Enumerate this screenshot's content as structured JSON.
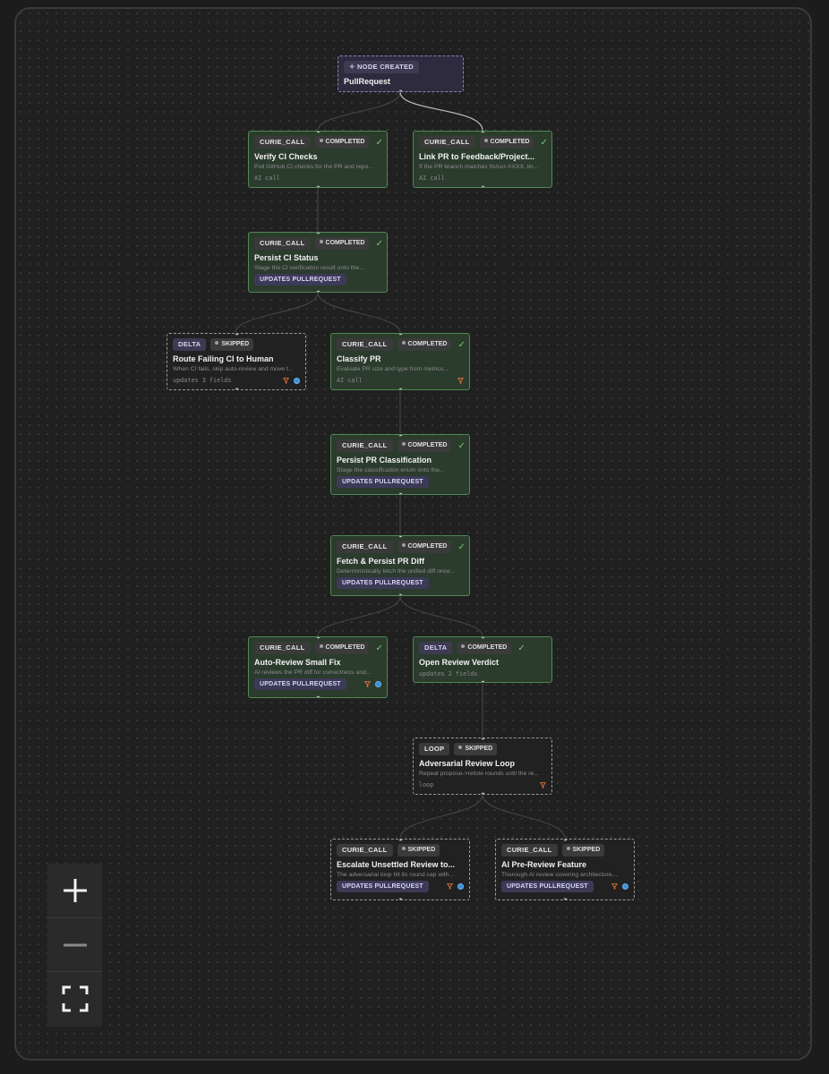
{
  "graph": {
    "root": {
      "kind": "NODE CREATED",
      "title": "PullRequest"
    },
    "nodes": [
      {
        "kind": "CURIE_CALL",
        "status": "COMPLETED",
        "title": "Verify CI Checks",
        "desc": "Poll GitHub CI checks for the PR and repo...",
        "footer": "AI call"
      },
      {
        "kind": "CURIE_CALL",
        "status": "COMPLETED",
        "title": "Link PR to Feedback/Project...",
        "desc": "If the PR branch matches fix/cur-XXXX, lin...",
        "footer": "AI call"
      },
      {
        "kind": "CURIE_CALL",
        "status": "COMPLETED",
        "title": "Persist CI Status",
        "desc": "Stage the CI verification result onto the...",
        "badge": "UPDATES PULLREQUEST"
      },
      {
        "kind": "DELTA",
        "status": "SKIPPED",
        "title": "Route Failing CI to Human",
        "desc": "When CI fails, skip auto-review and move t...",
        "footer": "updates 3 fields"
      },
      {
        "kind": "CURIE_CALL",
        "status": "COMPLETED",
        "title": "Classify PR",
        "desc": "Evaluate PR size and type from metrics...",
        "footer": "AI call"
      },
      {
        "kind": "CURIE_CALL",
        "status": "COMPLETED",
        "title": "Persist PR Classification",
        "desc": "Stage the classification enum onto the...",
        "badge": "UPDATES PULLREQUEST"
      },
      {
        "kind": "CURIE_CALL",
        "status": "COMPLETED",
        "title": "Fetch & Persist PR Diff",
        "desc": "Deterministically fetch the unified diff once...",
        "badge": "UPDATES PULLREQUEST"
      },
      {
        "kind": "CURIE_CALL",
        "status": "COMPLETED",
        "title": "Auto-Review Small Fix",
        "desc": "AI reviews the PR diff for correctness and...",
        "badge": "UPDATES PULLREQUEST"
      },
      {
        "kind": "DELTA",
        "status": "COMPLETED",
        "title": "Open Review Verdict",
        "footer": "updates 2 fields"
      },
      {
        "kind": "LOOP",
        "status": "SKIPPED",
        "title": "Adversarial Review Loop",
        "desc": "Repeat propose->refute rounds until the re...",
        "footer": "loop"
      },
      {
        "kind": "CURIE_CALL",
        "status": "SKIPPED",
        "title": "Escalate Unsettled Review to...",
        "desc": "The adversarial loop hit its round cap with...",
        "badge": "UPDATES PULLREQUEST"
      },
      {
        "kind": "CURIE_CALL",
        "status": "SKIPPED",
        "title": "AI Pre-Review Feature",
        "desc": "Thorough AI review covering architecture,...",
        "badge": "UPDATES PULLREQUEST"
      }
    ]
  },
  "controls": {
    "zoom_in": "+",
    "zoom_out": "−",
    "fit": "fit-view-icon"
  },
  "colors": {
    "completed_border": "#4e8a52",
    "completed_bg": "#2b3b2c",
    "check": "#6fcf73",
    "updates_badge": "#3d3a58"
  }
}
